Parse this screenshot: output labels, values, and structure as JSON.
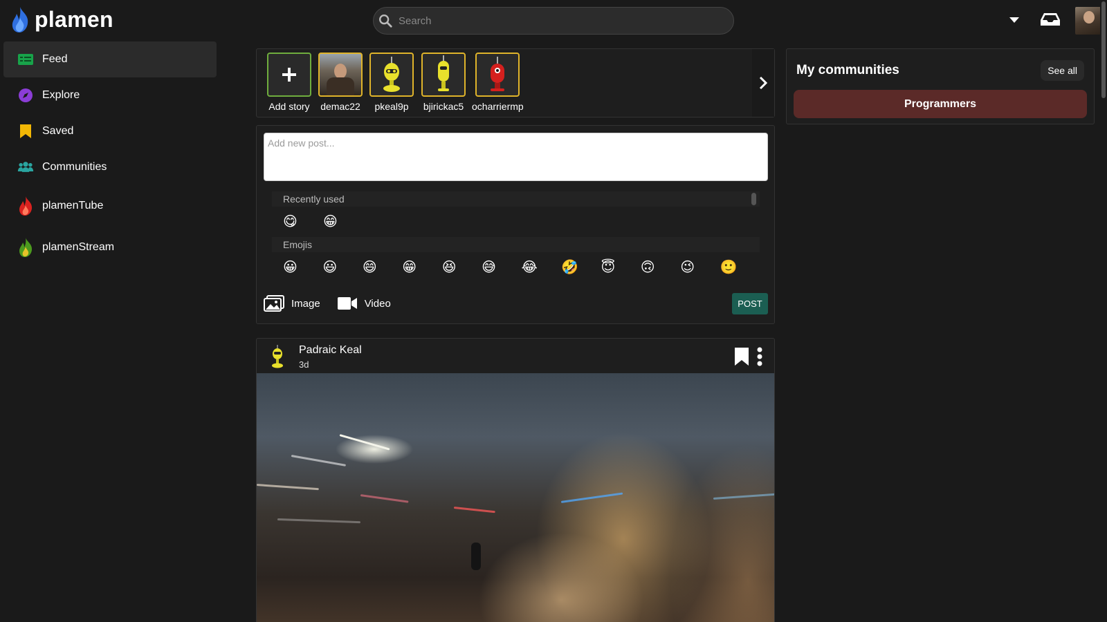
{
  "app": {
    "name": "plamen"
  },
  "search": {
    "placeholder": "Search"
  },
  "sidebar": {
    "items": [
      {
        "label": "Feed",
        "icon": "feed-icon",
        "active": true
      },
      {
        "label": "Explore",
        "icon": "compass-icon"
      },
      {
        "label": "Saved",
        "icon": "bookmark-icon"
      },
      {
        "label": "Communities",
        "icon": "users-icon"
      },
      {
        "label": "plamenTube",
        "icon": "red-flame-icon"
      },
      {
        "label": "plamenStream",
        "icon": "green-flame-icon"
      }
    ]
  },
  "stories": {
    "items": [
      {
        "name": "Add story",
        "type": "add"
      },
      {
        "name": "demac22",
        "type": "photo"
      },
      {
        "name": "pkeal9p",
        "type": "robot-yellow"
      },
      {
        "name": "bjirickac5",
        "type": "robot-yellow-tall"
      },
      {
        "name": "ocharriermp",
        "type": "robot-red"
      }
    ]
  },
  "composer": {
    "placeholder": "Add new post...",
    "emoji_categories": {
      "recent_label": "Recently used",
      "recent": [
        "😋",
        "😁"
      ],
      "emojis_label": "Emojis",
      "emojis": [
        "😀",
        "😃",
        "😄",
        "😁",
        "😆",
        "😅",
        "😂",
        "🤣",
        "😇",
        "🙃",
        "😉",
        "🙂"
      ]
    },
    "image_label": "Image",
    "video_label": "Video",
    "post_label": "POST"
  },
  "post": {
    "author": "Padraic Keal",
    "time": "3d"
  },
  "communities": {
    "heading": "My communities",
    "see_all": "See all",
    "items": [
      "Programmers"
    ]
  },
  "colors": {
    "background": "#1a1a1a",
    "panel": "#1e1e1e",
    "story_border": "#e0b42a",
    "add_story_border": "#6fae3e",
    "post_button": "#1b5e52",
    "community_button": "#5b2a28"
  }
}
